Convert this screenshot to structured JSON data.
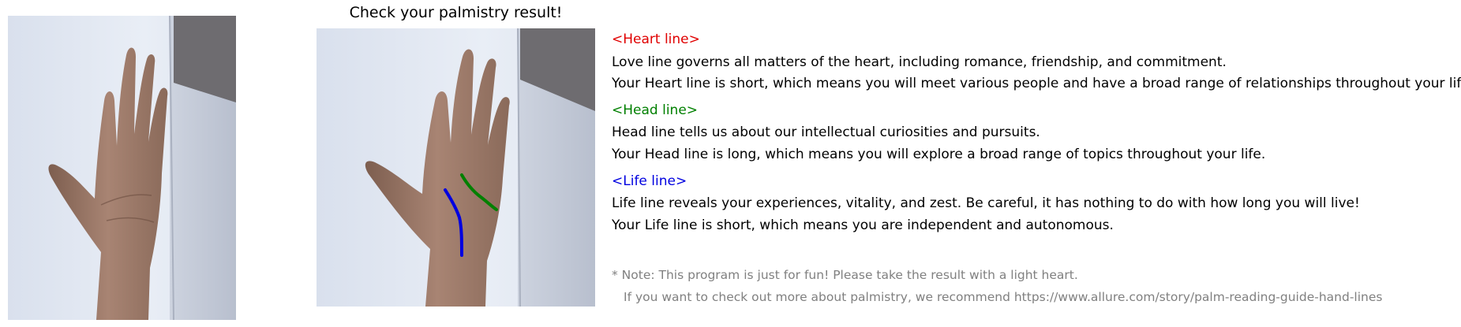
{
  "title": "Check your palmistry result!",
  "colors": {
    "heart": "#e00000",
    "head": "#008000",
    "life": "#0000e0",
    "body_text": "#000000",
    "note_text": "#808080"
  },
  "sections": {
    "heart": {
      "header": "<Heart line>",
      "description": "Love line governs all matters of the heart, including romance, friendship, and commitment.",
      "result": "Your Heart line is short, which means you will meet various people and have a broad range of relationships throughout your life."
    },
    "head": {
      "header": "<Head line>",
      "description": "Head line tells us about our intellectual curiosities and pursuits.",
      "result": "Your Head line is long, which means you will explore a broad range of topics throughout your life."
    },
    "life": {
      "header": "<Life line>",
      "description": "Life line reveals your experiences, vitality, and zest. Be careful, it has nothing to do with how long you will live!",
      "result": "Your Life line is short, which means you are independent and autonomous."
    }
  },
  "note": {
    "line1": "* Note: This program is just for fun! Please take the result with a light heart.",
    "line2": "If you want to check out more about palmistry, we recommend https://www.allure.com/story/palm-reading-guide-hand-lines"
  }
}
